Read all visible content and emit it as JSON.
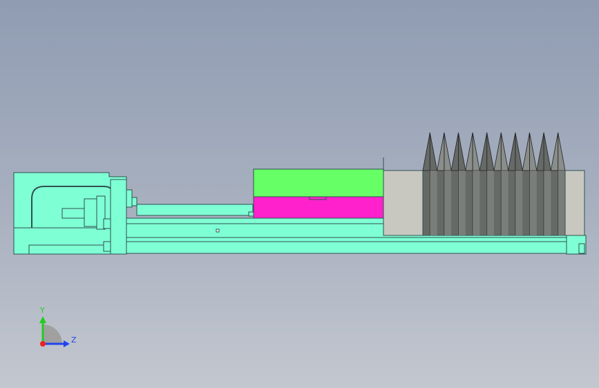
{
  "viewport": {
    "background_top": "#8f9cb2",
    "background_bottom": "#c3c7cf"
  },
  "colors": {
    "frame": "#7fffd4",
    "outline": "#2f4f4f",
    "carriage_top": "#66ff66",
    "carriage_bottom": "#ff22cc",
    "end_block": "#c8c8c0",
    "bellows_dark": "#666a66",
    "bellows_light": "#8a8e8a",
    "axis_y": "#22cc22",
    "axis_z": "#2244ee",
    "axis_x": "#ee2222"
  },
  "bellows": {
    "fold_count": 10
  },
  "triad": {
    "icon": "coordinate-triad-icon",
    "y_label": "Y",
    "z_label": "Z"
  }
}
